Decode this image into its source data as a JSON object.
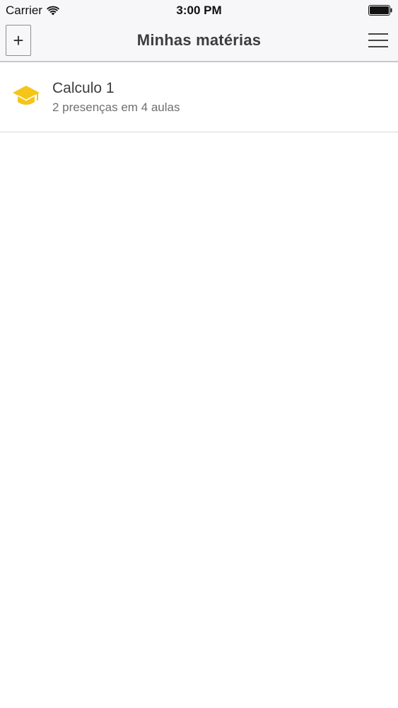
{
  "status_bar": {
    "carrier": "Carrier",
    "time": "3:00 PM",
    "wifi_icon": "wifi-icon",
    "battery_icon": "battery-icon"
  },
  "nav_bar": {
    "add_label": "+",
    "title": "Minhas matérias",
    "menu_icon": "hamburger-menu-icon"
  },
  "subjects": [
    {
      "icon": "graduation-cap-icon",
      "icon_color": "#f5c518",
      "name": "Calculo 1",
      "summary": "2 presenças em 4 aulas"
    }
  ]
}
